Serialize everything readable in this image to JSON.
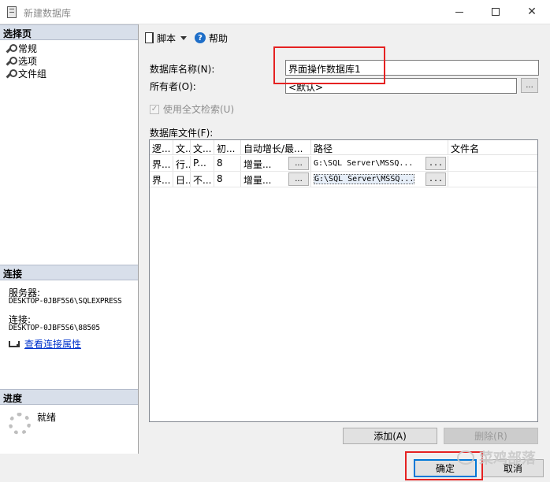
{
  "window": {
    "title": "新建数据库",
    "icons": {
      "app": "database-file-icon",
      "minimize": "minimize-icon",
      "maximize": "maximize-icon",
      "close": "close-icon"
    }
  },
  "sidebar": {
    "select_page_header": "选择页",
    "pages": [
      {
        "label": "常规",
        "icon": "wrench-icon"
      },
      {
        "label": "选项",
        "icon": "wrench-icon"
      },
      {
        "label": "文件组",
        "icon": "wrench-icon"
      }
    ],
    "connection_header": "连接",
    "server_label": "服务器:",
    "server_value": "DESKTOP-0JBF5S6\\SQLEXPRESS",
    "connection_label": "连接:",
    "connection_value": "DESKTOP-0JBF5S6\\88505",
    "view_connection_link": "查看连接属性",
    "progress_header": "进度",
    "progress_status": "就绪"
  },
  "toolbar": {
    "script_label": "脚本",
    "help_label": "帮助"
  },
  "form": {
    "db_name_label": "数据库名称(N):",
    "db_name_value": "界面操作数据库1",
    "owner_label": "所有者(O):",
    "owner_value": "<默认>",
    "owner_browse": "...",
    "fulltext_label": "使用全文检索(U)",
    "fulltext_checked": true,
    "files_label": "数据库文件(F):"
  },
  "grid": {
    "columns": [
      "逻...",
      "文...",
      "文...",
      "初...",
      "自动增长/最...",
      "路径",
      "文件名"
    ],
    "rows": [
      {
        "logical": "界...",
        "type": "行...",
        "group": "P...",
        "initial": "8",
        "autogrowth": "增量...",
        "path": "G:\\SQL Server\\MSSQ...",
        "filename": ""
      },
      {
        "logical": "界...",
        "type": "日...",
        "group": "不...",
        "initial": "8",
        "autogrowth": "增量...",
        "path": "G:\\SQL Server\\MSSQ...",
        "filename": ""
      }
    ],
    "cell_button": "..."
  },
  "actions": {
    "add": "添加(A)",
    "remove": "删除(R)",
    "ok": "确定",
    "cancel": "取消"
  },
  "watermark": "菜鸡部落"
}
